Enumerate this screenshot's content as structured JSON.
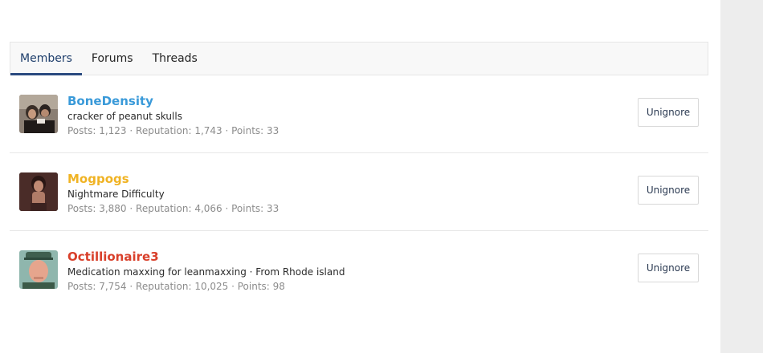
{
  "tabs": [
    {
      "label": "Members",
      "active": true
    },
    {
      "label": "Forums",
      "active": false
    },
    {
      "label": "Threads",
      "active": false
    }
  ],
  "members": [
    {
      "username": "BoneDensity",
      "username_color": "#3a9ad9",
      "blurb": "cracker of peanut skulls",
      "stats": "Posts: 1,123 · Reputation: 1,743 · Points: 33",
      "action": "Unignore",
      "avatar": "photo-avatar"
    },
    {
      "username": "Mogpogs",
      "username_color": "#f0b323",
      "blurb": "Nightmare Difficulty",
      "stats": "Posts: 3,880 · Reputation: 4,066 · Points: 33",
      "action": "Unignore",
      "avatar": "photo-avatar"
    },
    {
      "username": "Octillionaire3",
      "username_color": "#d9402b",
      "blurb": "Medication maxxing for leanmaxxing · From Rhode island",
      "stats": "Posts: 7,754 · Reputation: 10,025 · Points: 98",
      "action": "Unignore",
      "avatar": "photo-avatar"
    }
  ]
}
